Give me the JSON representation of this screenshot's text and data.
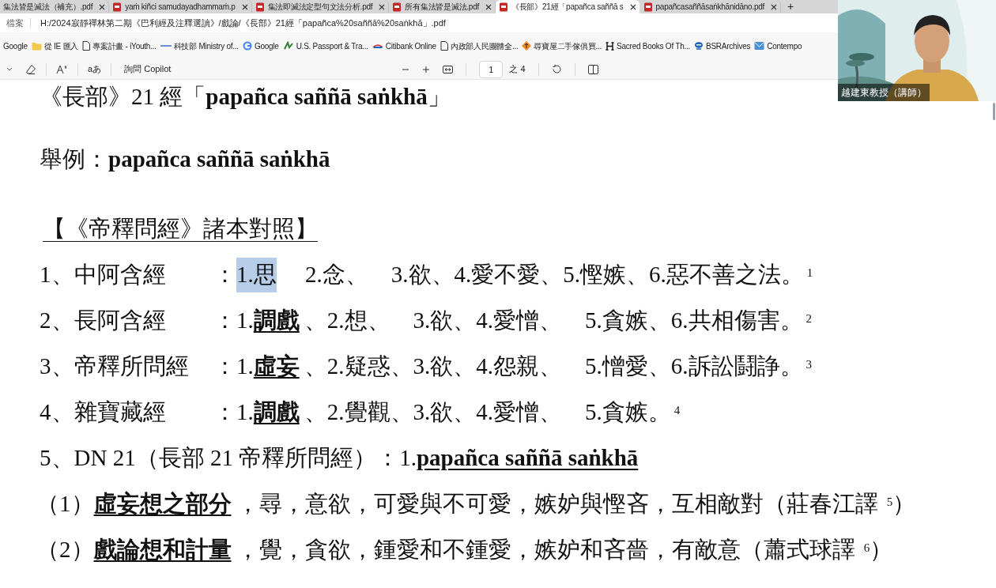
{
  "tabs": [
    {
      "label": "集法皆是滅法（補充）.pdf",
      "selected": false
    },
    {
      "label": "yaṁ kiñci samudayadhammaṁ.p",
      "selected": false
    },
    {
      "label": "集法即滅法定型句文法分析.pdf",
      "selected": false
    },
    {
      "label": "所有集法皆是滅法.pdf",
      "selected": false
    },
    {
      "label": "《長部》21經「papañca saññā s",
      "selected": true
    },
    {
      "label": "papañcasaññāsaṅkhānidāno.pdf",
      "selected": false
    }
  ],
  "new_tab": "+",
  "address_bar": {
    "scheme": "檔案",
    "url": "H:/2024寂靜禪林第二期《巴利經及注釋選讀》/戲論/《長部》21經「papañca%20saññā%20saṅkhā」.pdf"
  },
  "bookmarks": [
    {
      "label": "Google",
      "kind": "none"
    },
    {
      "label": "從 IE 匯入",
      "kind": "folder"
    },
    {
      "label": "專案計畫 - iYouth...",
      "kind": "page"
    },
    {
      "label": "科技部 Ministry of...",
      "kind": "line"
    },
    {
      "label": "Google",
      "kind": "google"
    },
    {
      "label": "U.S. Passport & Tra...",
      "kind": "leaf"
    },
    {
      "label": "Citibank Online",
      "kind": "citi"
    },
    {
      "label": "內政部人民團體全...",
      "kind": "page"
    },
    {
      "label": "尋寶屋二手傢俱買...",
      "kind": "arrow"
    },
    {
      "label": "Sacred Books Of Th...",
      "kind": "h"
    },
    {
      "label": "BSRArchives",
      "kind": "chat"
    },
    {
      "label": "Contempo",
      "kind": "mail"
    }
  ],
  "pdf_toolbar": {
    "copilot": "詢問 Copilot",
    "read_aloud": "aあ",
    "page": "1",
    "page_total": "之 4"
  },
  "video": {
    "name": "越建東教授（講師）"
  },
  "document": [
    {
      "kind": "heading",
      "parts": [
        {
          "text": "《長部》21 經「",
          "kind": "plain"
        },
        {
          "text": "papañca saññā saṅkhā",
          "kind": "bold"
        },
        {
          "text": "」",
          "kind": "plain"
        }
      ]
    },
    {
      "kind": "para",
      "parts": [
        {
          "text": "舉例：",
          "kind": "plain"
        },
        {
          "text": "papañca saññā saṅkhā",
          "kind": "bold"
        }
      ]
    },
    {
      "kind": "section",
      "parts": [
        {
          "text": "【《帝釋問經》諸本對照】",
          "kind": "underline"
        }
      ]
    },
    {
      "kind": "item",
      "label": "1、中阿含經",
      "parts": [
        {
          "text": "：",
          "kind": "plain"
        },
        {
          "text": "1.思",
          "kind": "selected"
        },
        {
          "text": "　 2.念、　3.欲、4.愛不愛、5.慳嫉、6.惡不善之法。",
          "kind": "plain"
        },
        {
          "text": "1",
          "kind": "note"
        }
      ]
    },
    {
      "kind": "item",
      "label": "2、長阿含經",
      "parts": [
        {
          "text": "：1.",
          "kind": "plain"
        },
        {
          "text": "調戲",
          "kind": "emph"
        },
        {
          "text": "、2.想、　3.欲、4.愛憎、　5.貪嫉、6.共相傷害。",
          "kind": "plain"
        },
        {
          "text": "2",
          "kind": "note"
        }
      ]
    },
    {
      "kind": "item",
      "label": "3、帝釋所問經",
      "parts": [
        {
          "text": "：1.",
          "kind": "plain"
        },
        {
          "text": "虛妄",
          "kind": "emph"
        },
        {
          "text": "、2.疑惑、3.欲、4.怨親、　5.憎愛、6.訴訟鬪諍。",
          "kind": "plain"
        },
        {
          "text": "3",
          "kind": "note"
        }
      ]
    },
    {
      "kind": "item",
      "label": "4、雜寶藏經",
      "parts": [
        {
          "text": "：1.",
          "kind": "plain"
        },
        {
          "text": "調戲",
          "kind": "emph"
        },
        {
          "text": "、2.覺觀、3.欲、4.愛憎、　5.貪嫉。",
          "kind": "plain"
        },
        {
          "text": "4",
          "kind": "note"
        }
      ]
    },
    {
      "kind": "para",
      "parts": [
        {
          "text": "5、DN 21（長部 21 帝釋所問經）：1.",
          "kind": "plain"
        },
        {
          "text": "papañca saññā saṅkhā",
          "kind": "emph"
        }
      ]
    },
    {
      "kind": "sub",
      "parts": [
        {
          "text": "（1）",
          "kind": "plain"
        },
        {
          "text": "虛妄想之部分",
          "kind": "emph"
        },
        {
          "text": "，尋，意欲，可愛與不可愛，嫉妒與慳吝，互相敵對（莊春江譯 ",
          "kind": "plain"
        },
        {
          "text": "5",
          "kind": "note"
        },
        {
          "text": "）",
          "kind": "plain"
        }
      ]
    },
    {
      "kind": "sub",
      "parts": [
        {
          "text": "（2）",
          "kind": "plain"
        },
        {
          "text": "戲論想和計量",
          "kind": "emph"
        },
        {
          "text": "，覺，貪欲，鍾愛和不鍾愛，嫉妒和吝嗇，有敵意（蕭式球譯 ",
          "kind": "plain"
        },
        {
          "text": "6",
          "kind": "note"
        },
        {
          "text": "）",
          "kind": "plain"
        }
      ]
    }
  ]
}
